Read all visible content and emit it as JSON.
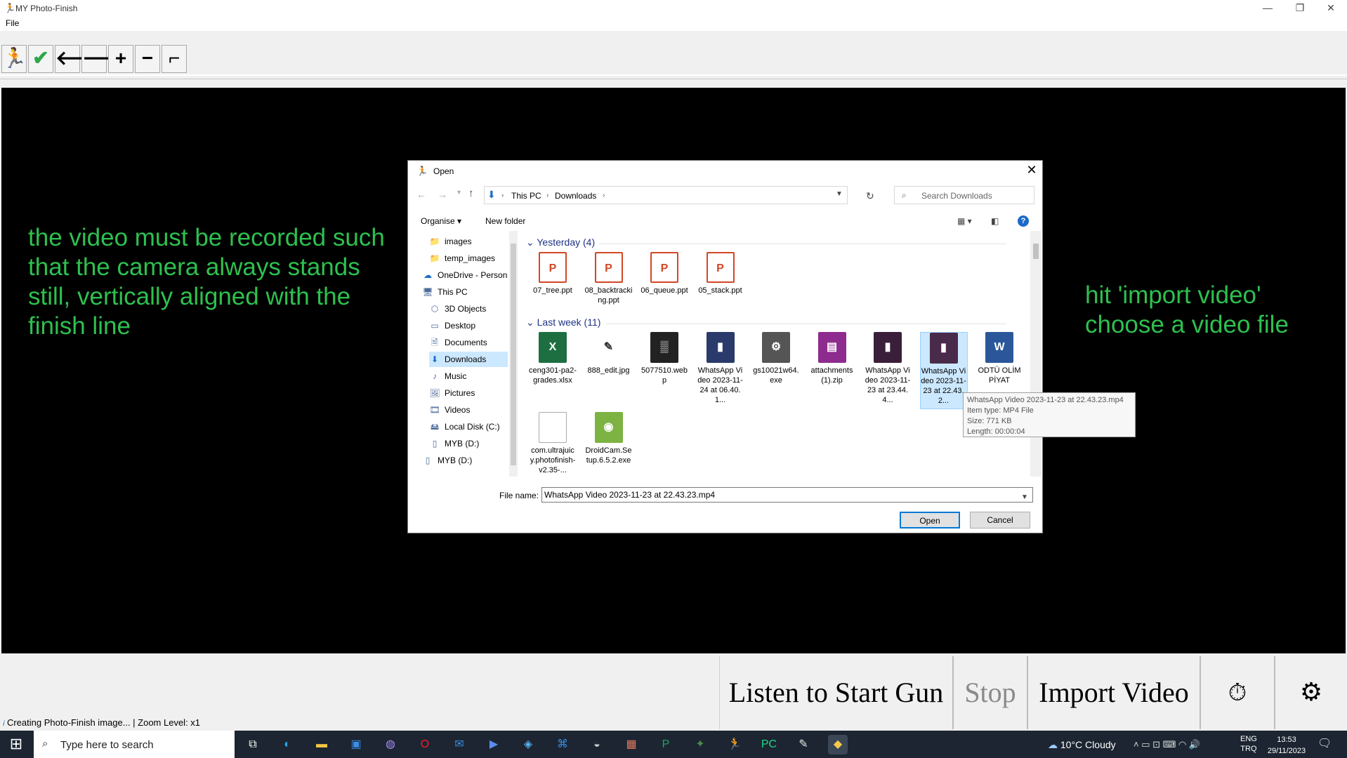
{
  "app": {
    "title": "MY Photo-Finish",
    "menu": [
      "File"
    ],
    "window_controls": [
      "minimize",
      "restore",
      "close"
    ]
  },
  "toolbar": {
    "buttons": [
      {
        "name": "runner-icon",
        "glyph": "🏃"
      },
      {
        "name": "check-icon",
        "glyph": "✔"
      },
      {
        "name": "arrow-left-icon",
        "glyph": "🡐"
      },
      {
        "name": "arrow-right-icon",
        "glyph": "🡒"
      },
      {
        "name": "plus-icon",
        "glyph": "+"
      },
      {
        "name": "minus-icon",
        "glyph": "−"
      },
      {
        "name": "pistol-icon",
        "glyph": "⌐"
      }
    ]
  },
  "hints": {
    "left": "the video must be recorded such that the camera always stands still, vertically aligned with the finish line",
    "right": "hit 'import video' choose a video file"
  },
  "dialog": {
    "title": "Open",
    "breadcrumb": [
      "This PC",
      "Downloads"
    ],
    "search_placeholder": "Search Downloads",
    "organise": "Organise ▾",
    "new_folder": "New folder",
    "nav_items": [
      {
        "label": "images",
        "icon": "folder-icon",
        "glyph": "📁",
        "indent": 1
      },
      {
        "label": "temp_images",
        "icon": "folder-icon",
        "glyph": "📁",
        "indent": 1
      },
      {
        "label": "OneDrive - Person",
        "icon": "cloud-icon",
        "glyph": "☁",
        "indent": 0
      },
      {
        "label": "This PC",
        "icon": "pc-icon",
        "glyph": "🖥",
        "indent": 0
      },
      {
        "label": "3D Objects",
        "icon": "cube-icon",
        "glyph": "⬡",
        "indent": 1
      },
      {
        "label": "Desktop",
        "icon": "desktop-icon",
        "glyph": "▭",
        "indent": 1
      },
      {
        "label": "Documents",
        "icon": "documents-icon",
        "glyph": "🗎",
        "indent": 1
      },
      {
        "label": "Downloads",
        "icon": "download-icon",
        "glyph": "⬇",
        "indent": 1,
        "selected": true
      },
      {
        "label": "Music",
        "icon": "music-icon",
        "glyph": "♪",
        "indent": 1
      },
      {
        "label": "Pictures",
        "icon": "pictures-icon",
        "glyph": "🖼",
        "indent": 1
      },
      {
        "label": "Videos",
        "icon": "videos-icon",
        "glyph": "🎞",
        "indent": 1
      },
      {
        "label": "Local Disk (C:)",
        "icon": "disk-icon",
        "glyph": "🖴",
        "indent": 1
      },
      {
        "label": "MYB (D:)",
        "icon": "drive-icon",
        "glyph": "▯",
        "indent": 1
      },
      {
        "label": "MYB (D:)",
        "icon": "drive-icon",
        "glyph": "▯",
        "indent": 0
      }
    ],
    "groups": [
      {
        "header": "Yesterday (4)",
        "files": [
          {
            "name": "07_tree.ppt",
            "icon": "ppt-icon",
            "color": "#d24726",
            "label": "P"
          },
          {
            "name": "08_backtracking.ppt",
            "icon": "ppt-icon",
            "color": "#d24726",
            "label": "P"
          },
          {
            "name": "06_queue.ppt",
            "icon": "ppt-icon",
            "color": "#d24726",
            "label": "P"
          },
          {
            "name": "05_stack.ppt",
            "icon": "ppt-icon",
            "color": "#d24726",
            "label": "P"
          }
        ]
      },
      {
        "header": "Last week (11)",
        "files": [
          {
            "name": "ceng301-pa2-grades.xlsx",
            "icon": "excel-icon",
            "color": "#1d6f42",
            "label": "X"
          },
          {
            "name": "888_edit.jpg",
            "icon": "image-edit-icon",
            "color": "#333333",
            "label": "✎"
          },
          {
            "name": "5077510.webp",
            "icon": "image-icon",
            "color": "#222222",
            "label": "▒"
          },
          {
            "name": "WhatsApp Video 2023-11-24 at 06.40.1...",
            "icon": "video-thumb-icon",
            "color": "#2a3a6a",
            "label": "▮"
          },
          {
            "name": "gs10021w64.exe",
            "icon": "installer-icon",
            "color": "#555555",
            "label": "⚙"
          },
          {
            "name": "attachments (1).zip",
            "icon": "zip-icon",
            "color": "#8e2b8e",
            "label": "▤"
          },
          {
            "name": "WhatsApp Video 2023-11-23 at 23.44.4...",
            "icon": "video-thumb-icon",
            "color": "#3a1f3a",
            "label": "▮"
          },
          {
            "name": "WhatsApp Video 2023-11-23 at 22.43.2...",
            "icon": "video-thumb-icon",
            "color": "#4a2a4a",
            "label": "▮",
            "selected": true
          },
          {
            "name": "ODTÜ OLİMPİYAT",
            "icon": "word-icon",
            "color": "#2b579a",
            "label": "W"
          },
          {
            "name": "com.ultrajuicy.photofinish-v2.35-...",
            "icon": "file-icon",
            "color": "#dddddd",
            "label": ""
          },
          {
            "name": "DroidCam.Setup.6.5.2.exe",
            "icon": "android-icon",
            "color": "#7cb342",
            "label": "◉"
          }
        ]
      }
    ],
    "tooltip": [
      "WhatsApp Video 2023-11-23 at 22.43.23.mp4",
      "Item type: MP4 File",
      "Size: 771 KB",
      "Length: 00:00:04"
    ],
    "file_name_label": "File name:",
    "file_name_value": "WhatsApp Video 2023-11-23 at 22.43.23.mp4",
    "open_label": "Open",
    "cancel_label": "Cancel"
  },
  "bottom": {
    "listen": "Listen to Start Gun",
    "stop": "Stop",
    "import": "Import Video",
    "timer_icon": "stopwatch-icon",
    "settings_icon": "gear-icon",
    "status": "Creating Photo-Finish image... | Zoom Level: x1"
  },
  "taskbar": {
    "search_placeholder": "Type here to search",
    "weather": "10°C  Cloudy",
    "lang": [
      "ENG",
      "TRQ"
    ],
    "time": "13:53",
    "date": "29/11/2023",
    "apps": [
      {
        "name": "task-view-icon",
        "glyph": "⧉",
        "color": "#ffffff"
      },
      {
        "name": "edge-icon",
        "glyph": "◐",
        "color": "#2fa6e6"
      },
      {
        "name": "explorer-icon",
        "glyph": "▬",
        "color": "#f4c542"
      },
      {
        "name": "store-icon",
        "glyph": "▣",
        "color": "#3a8ee6"
      },
      {
        "name": "app-swirl-icon",
        "glyph": "◍",
        "color": "#a78bfa"
      },
      {
        "name": "opera-icon",
        "glyph": "O",
        "color": "#ff1b2d"
      },
      {
        "name": "mail-icon",
        "glyph": "✉",
        "color": "#3a8ee6"
      },
      {
        "name": "app-chevron-icon",
        "glyph": "▶",
        "color": "#5b8def"
      },
      {
        "name": "safari-icon",
        "glyph": "◈",
        "color": "#5ab4f0"
      },
      {
        "name": "vscode-icon",
        "glyph": "⌘",
        "color": "#3a8ee6"
      },
      {
        "name": "disk-app-icon",
        "glyph": "◒",
        "color": "#cccccc"
      },
      {
        "name": "app-grid-icon",
        "glyph": "▦",
        "color": "#e07a5f"
      },
      {
        "name": "powerpoint-app-icon",
        "glyph": "P",
        "color": "#1fa463"
      },
      {
        "name": "app-dark-icon",
        "glyph": "✦",
        "color": "#4a8a4a"
      },
      {
        "name": "runner-app-icon",
        "glyph": "🏃",
        "color": "#e23b3b"
      },
      {
        "name": "pycharm-icon",
        "glyph": "PC",
        "color": "#21d789"
      },
      {
        "name": "paint-icon",
        "glyph": "✎",
        "color": "#e6e6e6"
      },
      {
        "name": "python-icon",
        "glyph": "◆",
        "color": "#f7c948"
      }
    ]
  }
}
